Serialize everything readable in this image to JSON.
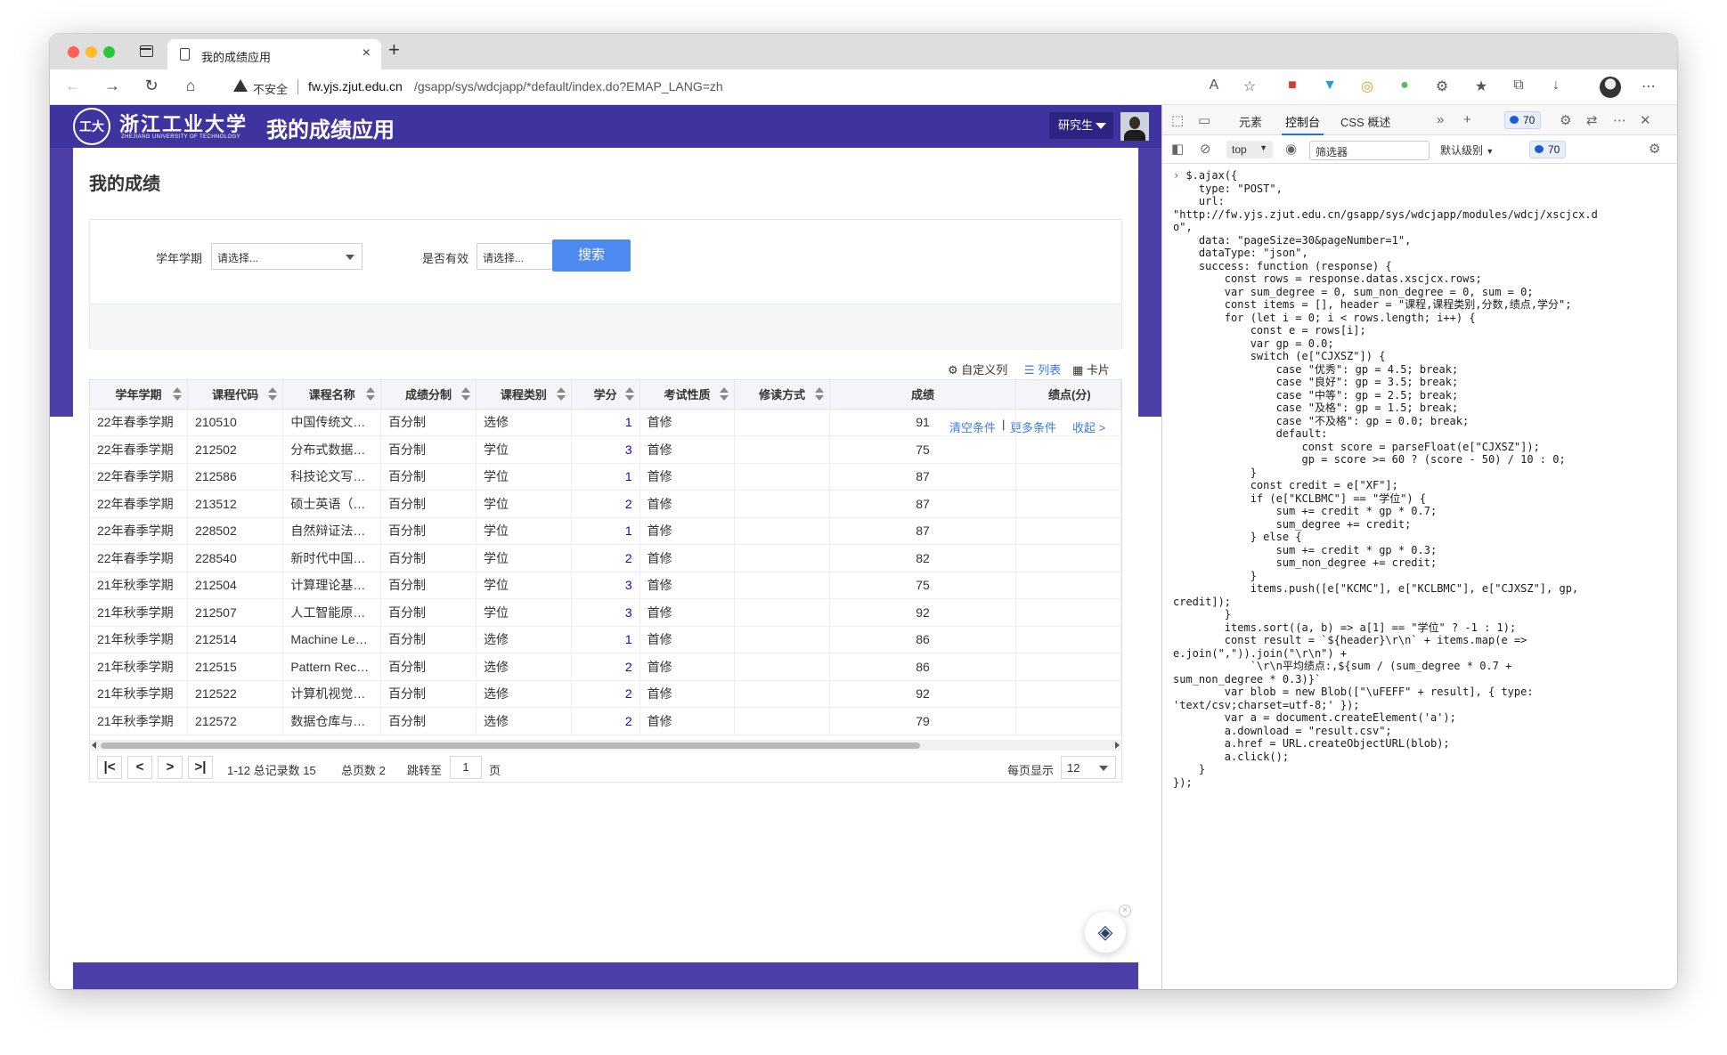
{
  "browser": {
    "tab_title": "我的成绩应用",
    "new_tab": "+",
    "close_tab": "×",
    "security_label": "不安全",
    "url_host": "fw.yjs.zjut.edu.cn",
    "url_path": "/gsapp/sys/wdcjapp/*default/index.do?EMAP_LANG=zh"
  },
  "app_header": {
    "logo_seal": "工大",
    "logo_cn": "浙江工业大学",
    "logo_en": "ZHEJIANG UNIVERSITY OF TECHNOLOGY",
    "title": "我的成绩应用",
    "role": "研究生"
  },
  "page": {
    "title": "我的成绩",
    "filters": {
      "term_label": "学年学期",
      "term_placeholder": "请选择...",
      "valid_label": "是否有效",
      "valid_placeholder": "请选择..."
    },
    "search_button": "搜索",
    "clear_link": "清空条件",
    "separator": "|",
    "more_link": "更多条件",
    "collapse_link": "收起 >",
    "custom_columns": "自定义列",
    "list_view": "列表",
    "card_view": "卡片"
  },
  "table": {
    "headers": [
      "学年学期",
      "课程代码",
      "课程名称",
      "成绩分制",
      "课程类别",
      "学分",
      "考试性质",
      "修读方式",
      "成绩",
      "绩点(分)"
    ],
    "rows": [
      [
        "22年春季学期",
        "210510",
        "中国传统文…",
        "百分制",
        "选修",
        "1",
        "首修",
        "",
        "91",
        ""
      ],
      [
        "22年春季学期",
        "212502",
        "分布式数据…",
        "百分制",
        "学位",
        "3",
        "首修",
        "",
        "75",
        ""
      ],
      [
        "22年春季学期",
        "212586",
        "科技论文写…",
        "百分制",
        "学位",
        "1",
        "首修",
        "",
        "87",
        ""
      ],
      [
        "22年春季学期",
        "213512",
        "硕士英语（…",
        "百分制",
        "学位",
        "2",
        "首修",
        "",
        "87",
        ""
      ],
      [
        "22年春季学期",
        "228502",
        "自然辩证法…",
        "百分制",
        "学位",
        "1",
        "首修",
        "",
        "87",
        ""
      ],
      [
        "22年春季学期",
        "228540",
        "新时代中国…",
        "百分制",
        "学位",
        "2",
        "首修",
        "",
        "82",
        ""
      ],
      [
        "21年秋季学期",
        "212504",
        "计算理论基…",
        "百分制",
        "学位",
        "3",
        "首修",
        "",
        "75",
        ""
      ],
      [
        "21年秋季学期",
        "212507",
        "人工智能原…",
        "百分制",
        "学位",
        "3",
        "首修",
        "",
        "92",
        ""
      ],
      [
        "21年秋季学期",
        "212514",
        "Machine Le…",
        "百分制",
        "选修",
        "1",
        "首修",
        "",
        "86",
        ""
      ],
      [
        "21年秋季学期",
        "212515",
        "Pattern Rec…",
        "百分制",
        "选修",
        "2",
        "首修",
        "",
        "86",
        ""
      ],
      [
        "21年秋季学期",
        "212522",
        "计算机视觉…",
        "百分制",
        "选修",
        "2",
        "首修",
        "",
        "92",
        ""
      ],
      [
        "21年秋季学期",
        "212572",
        "数据仓库与…",
        "百分制",
        "选修",
        "2",
        "首修",
        "",
        "79",
        ""
      ]
    ]
  },
  "pager": {
    "first": "|<",
    "prev": "<",
    "next": ">",
    "last": ">|",
    "range": "1-12 总记录数 15",
    "pages": "总页数 2",
    "jump_label": "跳转至",
    "page_value": "1",
    "page_unit": "页",
    "size_label": "每页显示",
    "size_value": "12"
  },
  "devtools": {
    "tabs": [
      "元素",
      "控制台",
      "CSS 概述"
    ],
    "active_tab": "控制台",
    "issues_count": "70",
    "context": "top",
    "filter_placeholder": "筛选器",
    "level": "默认级别",
    "console_lines": [
      "$.ajax({",
      "    type: \"POST\",",
      "    url:",
      "\"http://fw.yjs.zjut.edu.cn/gsapp/sys/wdcjapp/modules/wdcj/xscjcx.d",
      "o\",",
      "    data: \"pageSize=30&pageNumber=1\",",
      "    dataType: \"json\",",
      "    success: function (response) {",
      "        const rows = response.datas.xscjcx.rows;",
      "        var sum_degree = 0, sum_non_degree = 0, sum = 0;",
      "        const items = [], header = \"课程,课程类别,分数,绩点,学分\";",
      "",
      "        for (let i = 0; i < rows.length; i++) {",
      "            const e = rows[i];",
      "            var gp = 0.0;",
      "            switch (e[\"CJXSZ\"]) {",
      "                case \"优秀\": gp = 4.5; break;",
      "                case \"良好\": gp = 3.5; break;",
      "                case \"中等\": gp = 2.5; break;",
      "                case \"及格\": gp = 1.5; break;",
      "                case \"不及格\": gp = 0.0; break;",
      "                default:",
      "                    const score = parseFloat(e[\"CJXSZ\"]);",
      "                    gp = score >= 60 ? (score - 50) / 10 : 0;",
      "            }",
      "            const credit = e[\"XF\"];",
      "            if (e[\"KCLBMC\"] == \"学位\") {",
      "                sum += credit * gp * 0.7;",
      "                sum_degree += credit;",
      "            } else {",
      "                sum += credit * gp * 0.3;",
      "                sum_non_degree += credit;",
      "            }",
      "            items.push([e[\"KCMC\"], e[\"KCLBMC\"], e[\"CJXSZ\"], gp,",
      "credit]);",
      "        }",
      "        items.sort((a, b) => a[1] == \"学位\" ? -1 : 1);",
      "        const result = `${header}\\r\\n` + items.map(e =>",
      "e.join(\",\")).join(\"\\r\\n\") +",
      "            `\\r\\n平均绩点:,${sum / (sum_degree * 0.7 +",
      "sum_non_degree * 0.3)}`",
      "        var blob = new Blob([\"\\uFEFF\" + result], { type:",
      "'text/csv;charset=utf-8;' });",
      "        var a = document.createElement('a');",
      "        a.download = \"result.csv\";",
      "        a.href = URL.createObjectURL(blob);",
      "        a.click();",
      "    }",
      "});"
    ]
  }
}
